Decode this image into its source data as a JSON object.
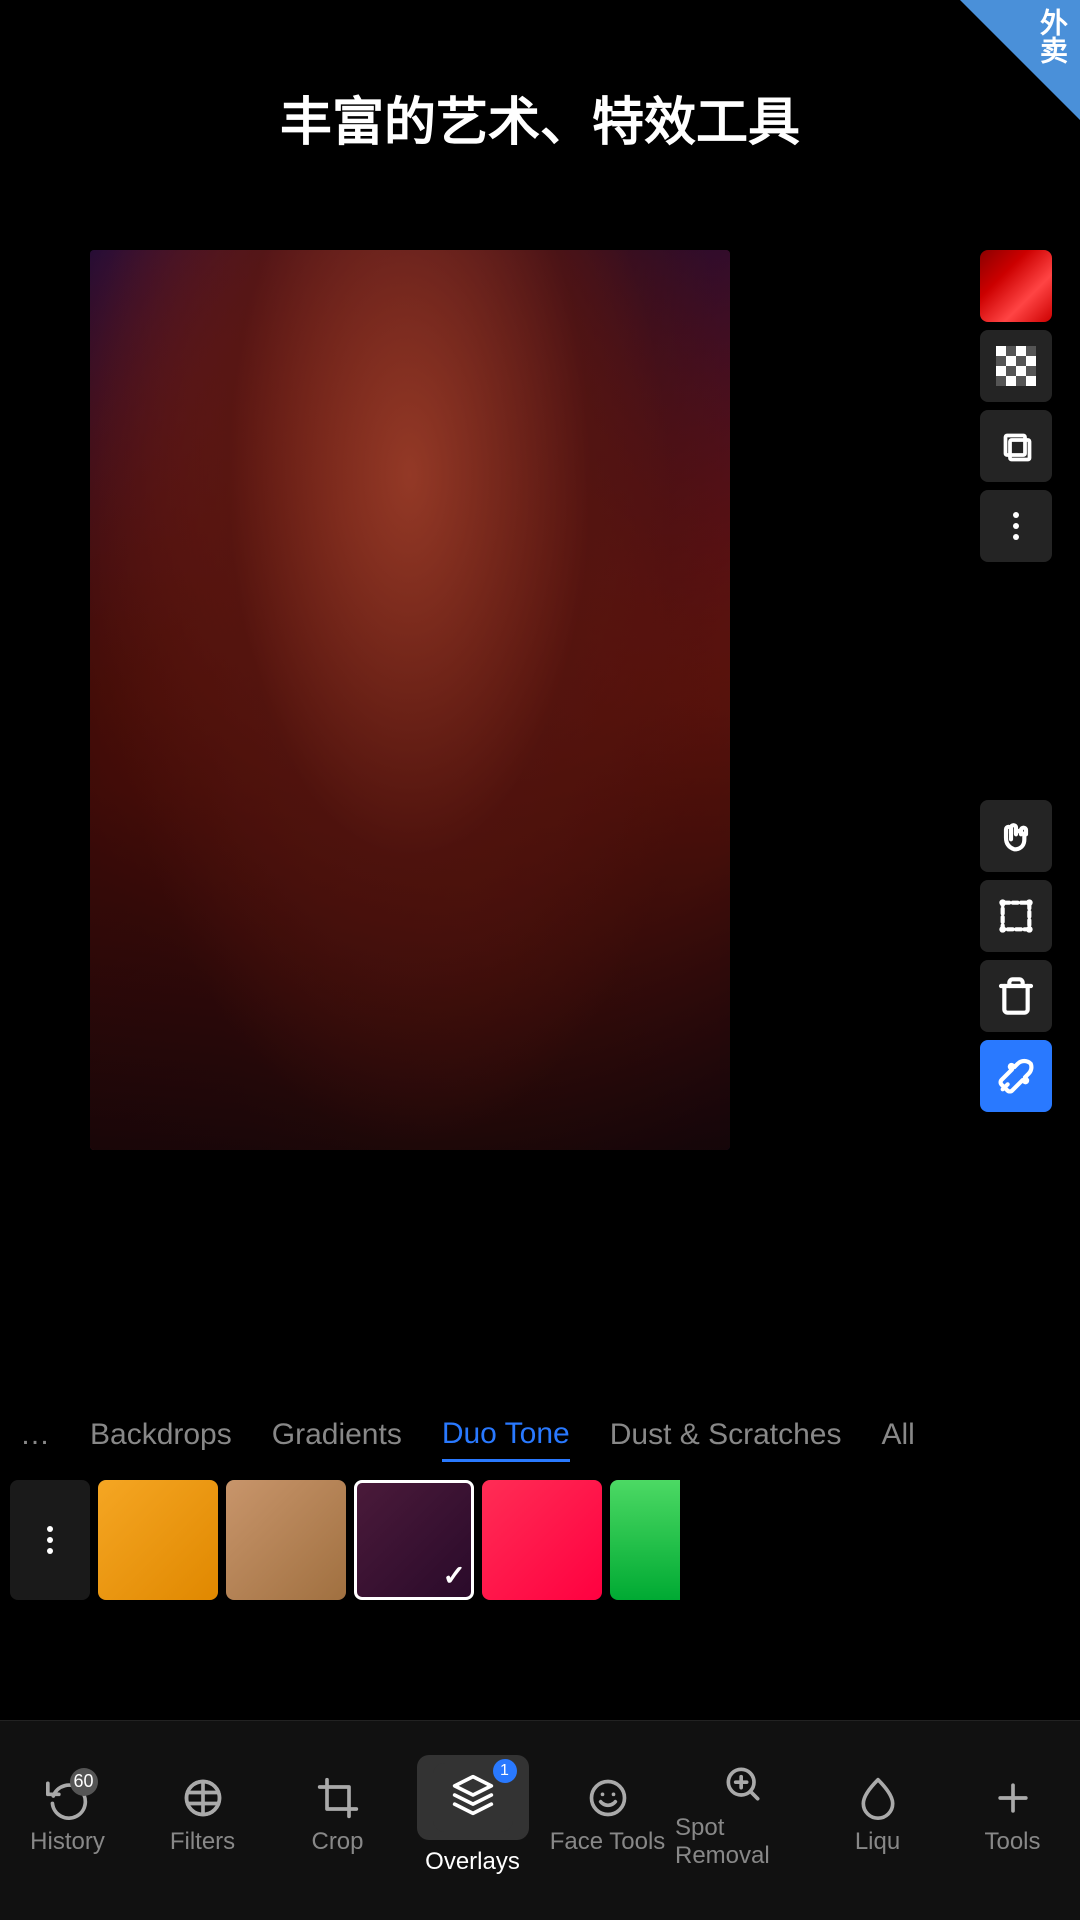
{
  "corner_badge": {
    "text": "外卖"
  },
  "page_title": "丰富的艺术、特效工具",
  "right_toolbar": {
    "color_swatch_label": "color-swatch",
    "transparency_label": "transparency",
    "layers_label": "layers",
    "more_label": "more-options",
    "hand_label": "hand-tool",
    "transform_label": "transform",
    "delete_label": "delete",
    "eyedropper_label": "eyedropper"
  },
  "category_tabs": [
    {
      "label": "Backdrops",
      "active": false
    },
    {
      "label": "Gradients",
      "active": false
    },
    {
      "label": "Duo Tone",
      "active": true
    },
    {
      "label": "Dust & Scratches",
      "active": false
    },
    {
      "label": "All",
      "active": false
    }
  ],
  "swatches": [
    {
      "color": "more",
      "label": "more"
    },
    {
      "color": "#f5a623",
      "label": "orange"
    },
    {
      "color": "#c8956b",
      "label": "tan"
    },
    {
      "color": "#4a1a3a",
      "label": "purple-dark",
      "selected": true
    },
    {
      "color": "#ff2d55",
      "label": "hot-pink"
    },
    {
      "color": "#4cd964",
      "label": "green-partial"
    }
  ],
  "bottom_nav": {
    "items": [
      {
        "label": "History",
        "badge": "60",
        "icon": "history",
        "active": false
      },
      {
        "label": "Filters",
        "icon": "filters",
        "active": false
      },
      {
        "label": "Crop",
        "icon": "crop",
        "active": false
      },
      {
        "label": "Overlays",
        "icon": "overlays",
        "active": true,
        "badge": "1"
      },
      {
        "label": "Face Tools",
        "icon": "face",
        "active": false
      },
      {
        "label": "Spot Removal",
        "icon": "spot",
        "active": false
      },
      {
        "label": "Liqu",
        "icon": "liqu",
        "active": false
      },
      {
        "label": "Tools",
        "icon": "tools",
        "active": false
      }
    ]
  }
}
